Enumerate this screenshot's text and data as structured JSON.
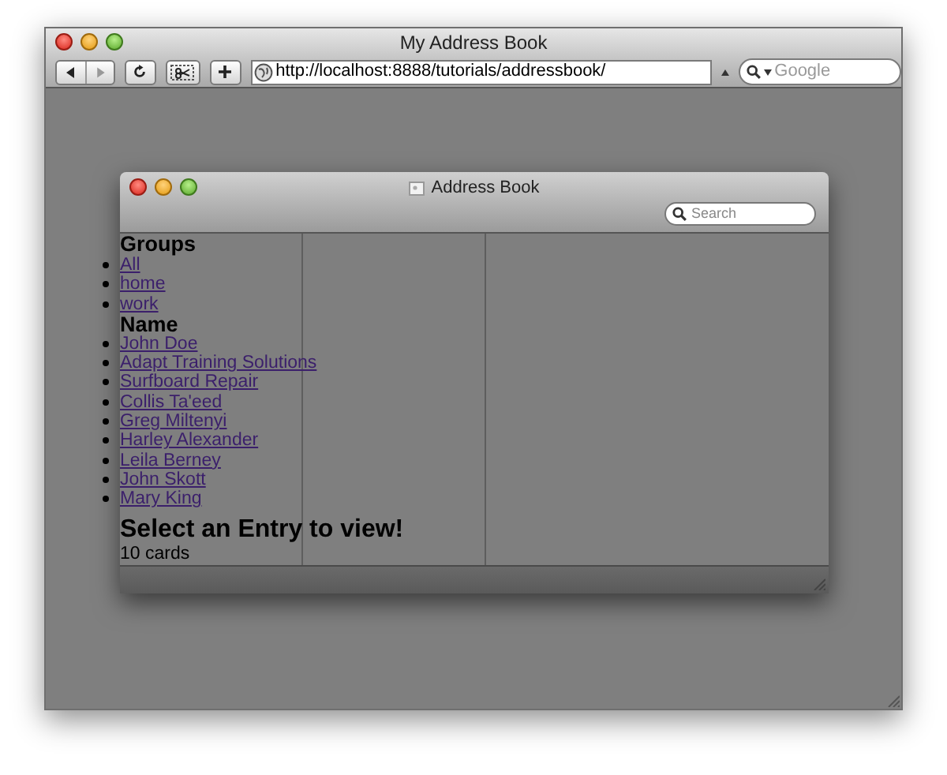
{
  "browser": {
    "title": "My Address Book",
    "url": "http://localhost:8888/tutorials/addressbook/",
    "search": {
      "placeholder": "Google"
    }
  },
  "app_window": {
    "title": "Address Book",
    "search": {
      "placeholder": "Search"
    },
    "groups": {
      "heading": "Groups",
      "items": [
        "All",
        "home",
        "work"
      ]
    },
    "names": {
      "heading": "Name",
      "items": [
        "John Doe",
        "Adapt Training Solutions",
        "Surfboard Repair",
        "Collis Ta'eed",
        "Greg Miltenyi",
        "Harley Alexander",
        "Leila Berney",
        "John Skott",
        "Mary King"
      ]
    },
    "message": "Select an Entry to view!",
    "count": "10 cards"
  }
}
